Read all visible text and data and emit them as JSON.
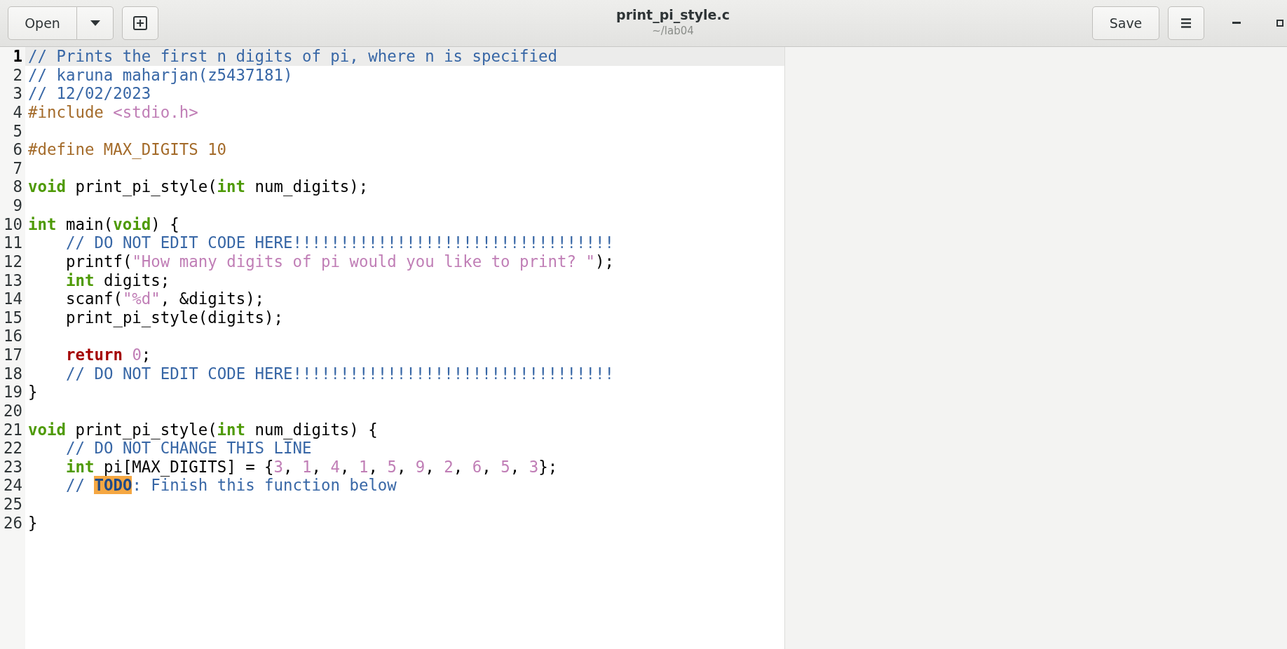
{
  "header": {
    "open_button": "Open",
    "title": "print_pi_style.c",
    "subtitle": "~/lab04",
    "save_button": "Save"
  },
  "lines": [
    {
      "number": "1",
      "current": true,
      "tokens": [
        {
          "text": "// Prints the first n digits of pi, where n is specified",
          "kind": "comment"
        }
      ]
    },
    {
      "number": "2",
      "current": false,
      "tokens": [
        {
          "text": "// karuna maharjan(z5437181)",
          "kind": "comment"
        }
      ]
    },
    {
      "number": "3",
      "current": false,
      "tokens": [
        {
          "text": "// 12/02/2023",
          "kind": "comment"
        }
      ]
    },
    {
      "number": "4",
      "current": false,
      "tokens": [
        {
          "text": "#include ",
          "kind": "preproc"
        },
        {
          "text": "<stdio.h>",
          "kind": "string"
        }
      ]
    },
    {
      "number": "5",
      "current": false
    },
    {
      "number": "6",
      "current": false,
      "tokens": [
        {
          "text": "#define MAX_DIGITS 10",
          "kind": "preproc"
        }
      ]
    },
    {
      "number": "7",
      "current": false
    },
    {
      "number": "8",
      "current": false,
      "tokens": [
        {
          "text": "void",
          "kind": "type"
        },
        {
          "text": " print_pi_style(",
          "kind": "plain"
        },
        {
          "text": "int",
          "kind": "type"
        },
        {
          "text": " num_digits);",
          "kind": "plain"
        }
      ]
    },
    {
      "number": "9",
      "current": false
    },
    {
      "number": "10",
      "current": false,
      "tokens": [
        {
          "text": "int",
          "kind": "type"
        },
        {
          "text": " main(",
          "kind": "plain"
        },
        {
          "text": "void",
          "kind": "type"
        },
        {
          "text": ") {",
          "kind": "plain"
        }
      ]
    },
    {
      "number": "11",
      "current": false,
      "indented": true,
      "tokens": [
        {
          "text": "// DO NOT EDIT CODE HERE!!!!!!!!!!!!!!!!!!!!!!!!!!!!!!!!!!",
          "kind": "comment"
        }
      ]
    },
    {
      "number": "12",
      "current": false,
      "indented": true,
      "tokens": [
        {
          "text": "printf(",
          "kind": "plain"
        },
        {
          "text": "\"How many digits of pi would you like to print? \"",
          "kind": "string"
        },
        {
          "text": ");",
          "kind": "plain"
        }
      ]
    },
    {
      "number": "13",
      "current": false,
      "indented": true,
      "tokens": [
        {
          "text": "int",
          "kind": "type"
        },
        {
          "text": " digits;",
          "kind": "plain"
        }
      ]
    },
    {
      "number": "14",
      "current": false,
      "indented": true,
      "tokens": [
        {
          "text": "scanf(",
          "kind": "plain"
        },
        {
          "text": "\"%d\"",
          "kind": "string"
        },
        {
          "text": ", &digits);",
          "kind": "plain"
        }
      ]
    },
    {
      "number": "15",
      "current": false,
      "indented": true,
      "tokens": [
        {
          "text": "print_pi_style(digits);",
          "kind": "plain"
        }
      ]
    },
    {
      "number": "16",
      "current": false
    },
    {
      "number": "17",
      "current": false,
      "indented": true,
      "tokens": [
        {
          "text": "return ",
          "kind": "statement"
        },
        {
          "text": "0",
          "kind": "number"
        },
        {
          "text": ";",
          "kind": "plain"
        }
      ]
    },
    {
      "number": "18",
      "current": false,
      "indented": true,
      "tokens": [
        {
          "text": "// DO NOT EDIT CODE HERE!!!!!!!!!!!!!!!!!!!!!!!!!!!!!!!!!!",
          "kind": "comment"
        }
      ]
    },
    {
      "number": "19",
      "current": false,
      "tokens": [
        {
          "text": "}",
          "kind": "plain"
        }
      ]
    },
    {
      "number": "20",
      "current": false
    },
    {
      "number": "21",
      "current": false,
      "tokens": [
        {
          "text": "void",
          "kind": "type"
        },
        {
          "text": " print_pi_style(",
          "kind": "plain"
        },
        {
          "text": "int",
          "kind": "type"
        },
        {
          "text": " num_digits) {",
          "kind": "plain"
        }
      ]
    },
    {
      "number": "22",
      "current": false,
      "indented": true,
      "tokens": [
        {
          "text": "// DO NOT CHANGE THIS LINE",
          "kind": "comment"
        }
      ]
    },
    {
      "number": "23",
      "current": false,
      "indented": true,
      "tokens": [
        {
          "text": "int",
          "kind": "type"
        },
        {
          "text": " pi[MAX_DIGITS] = {",
          "kind": "plain"
        },
        {
          "text": "3",
          "kind": "number"
        },
        {
          "text": ", ",
          "kind": "plain"
        },
        {
          "text": "1",
          "kind": "number"
        },
        {
          "text": ", ",
          "kind": "plain"
        },
        {
          "text": "4",
          "kind": "number"
        },
        {
          "text": ", ",
          "kind": "plain"
        },
        {
          "text": "1",
          "kind": "number"
        },
        {
          "text": ", ",
          "kind": "plain"
        },
        {
          "text": "5",
          "kind": "number"
        },
        {
          "text": ", ",
          "kind": "plain"
        },
        {
          "text": "9",
          "kind": "number"
        },
        {
          "text": ", ",
          "kind": "plain"
        },
        {
          "text": "2",
          "kind": "number"
        },
        {
          "text": ", ",
          "kind": "plain"
        },
        {
          "text": "6",
          "kind": "number"
        },
        {
          "text": ", ",
          "kind": "plain"
        },
        {
          "text": "5",
          "kind": "number"
        },
        {
          "text": ", ",
          "kind": "plain"
        },
        {
          "text": "3",
          "kind": "number"
        },
        {
          "text": "};",
          "kind": "plain"
        }
      ]
    },
    {
      "number": "24",
      "current": false,
      "indented": true,
      "tokens": [
        {
          "text": "// ",
          "kind": "comment"
        },
        {
          "text": "TODO",
          "kind": "todo"
        },
        {
          "text": ": Finish this function below",
          "kind": "comment"
        }
      ]
    },
    {
      "number": "25",
      "current": false
    },
    {
      "number": "26",
      "current": false,
      "tokens": [
        {
          "text": "}",
          "kind": "plain"
        }
      ]
    }
  ]
}
